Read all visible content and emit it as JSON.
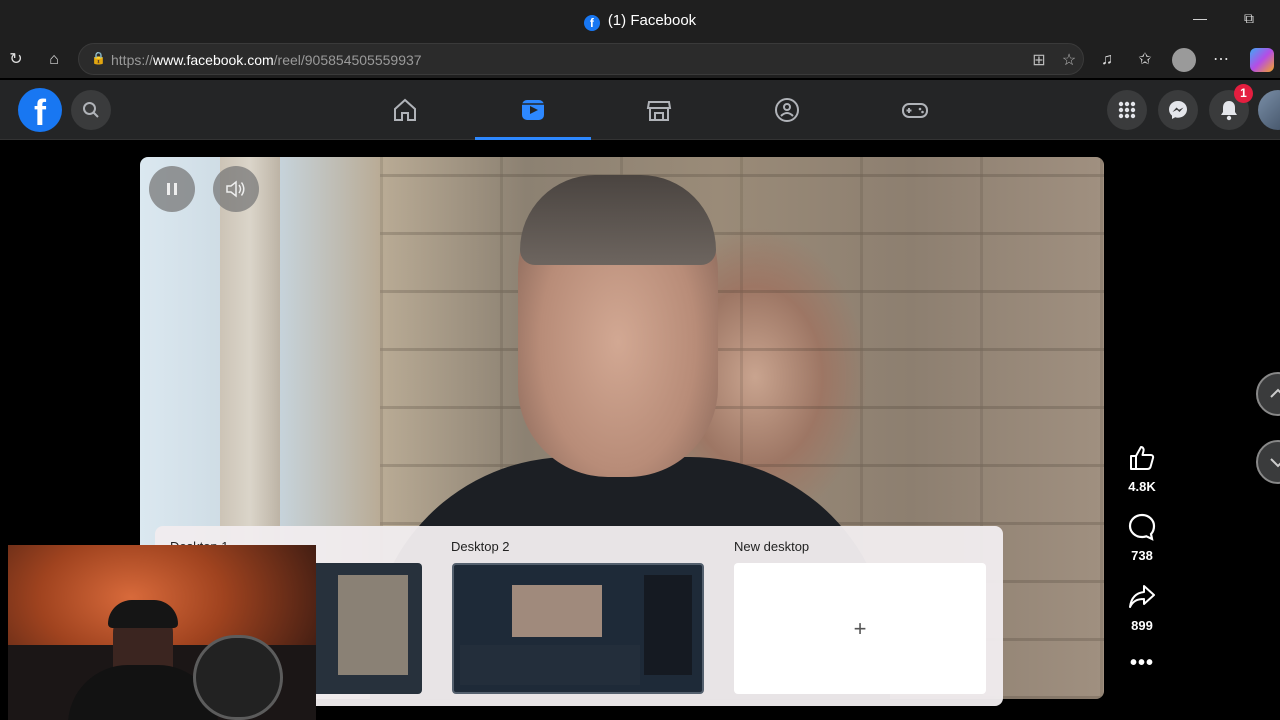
{
  "window": {
    "title": "(1) Facebook"
  },
  "browser": {
    "url_prefix": "https://",
    "url_host": "www.facebook.com",
    "url_path": "/reel/905854505559937"
  },
  "header": {
    "notification_count": "1",
    "nav_tabs": [
      {
        "name": "home",
        "active": false
      },
      {
        "name": "reels",
        "active": true
      },
      {
        "name": "marketplace",
        "active": false
      },
      {
        "name": "groups",
        "active": false
      },
      {
        "name": "gaming",
        "active": false
      }
    ]
  },
  "reel": {
    "likes": "4.8K",
    "comments": "738",
    "shares": "899"
  },
  "task_view": {
    "desktops": [
      {
        "label": "Desktop 1"
      },
      {
        "label": "Desktop 2"
      },
      {
        "label": "New desktop"
      }
    ],
    "new_desktop_symbol": "+"
  },
  "colors": {
    "facebook_blue": "#1877f2",
    "active_tab": "#2d88ff",
    "badge_red": "#e41e3f"
  }
}
